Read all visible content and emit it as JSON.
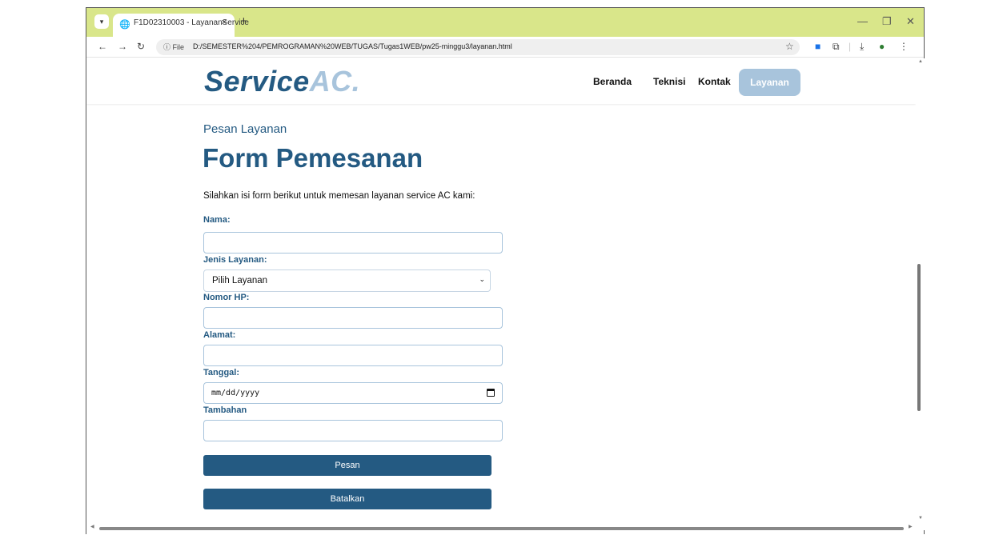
{
  "browser": {
    "tab_title": "F1D02310003 - LayananService",
    "tab_close": "×",
    "new_tab": "+",
    "omnibox_info": "ⓘ File",
    "url": "D:/SEMESTER%204/PEMROGRAMAN%20WEB/TUGAS/Tugas1WEB/pw25-minggu3/layanan.html"
  },
  "site": {
    "logo_part1": "Service",
    "logo_part2": "AC.",
    "nav": [
      "Beranda",
      "Teknisi",
      "Kontak",
      "Layanan"
    ]
  },
  "form": {
    "subtitle": "Pesan Layanan",
    "title": "Form Pemesanan",
    "intro": "Silahkan isi form berikut untuk memesan layanan service AC kami:",
    "nama_label": "Nama:",
    "jenis_label": "Jenis Layanan:",
    "jenis_selected": "Pilih Layanan",
    "hp_label": "Nomor HP:",
    "alamat_label": "Alamat:",
    "tanggal_label": "Tanggal:",
    "tanggal_placeholder": "mm/dd/yyyy",
    "tambahan_label": "Tambahan",
    "submit": "Pesan",
    "cancel": "Batalkan"
  },
  "colors": {
    "primary": "#245a82",
    "accent": "#a8c4dc",
    "tabbar": "#d9e68a"
  }
}
